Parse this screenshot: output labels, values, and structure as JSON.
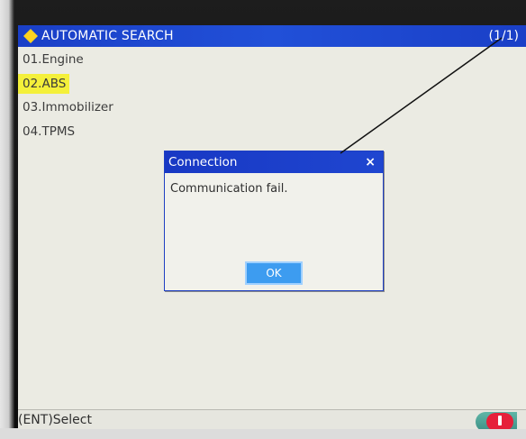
{
  "titlebar": {
    "title": "AUTOMATIC SEARCH",
    "page_indicator": "(1/1)",
    "icon": "diamond-icon"
  },
  "menu": {
    "items": [
      {
        "label": "01.Engine"
      },
      {
        "label": "02.ABS",
        "selected": true
      },
      {
        "label": "03.Immobilizer"
      },
      {
        "label": "04.TPMS"
      }
    ]
  },
  "dialog": {
    "title": "Connection",
    "close_symbol": "×",
    "message": "Communication fail.",
    "ok_label": "OK"
  },
  "statusbar": {
    "hint": "(ENT)Select",
    "alert_icon": "exclamation-icon"
  },
  "colors": {
    "title_bar": "#1a3fc7",
    "selection": "#f4f03a",
    "ok_button": "#3d9cf0",
    "alert": "#e6203a"
  }
}
